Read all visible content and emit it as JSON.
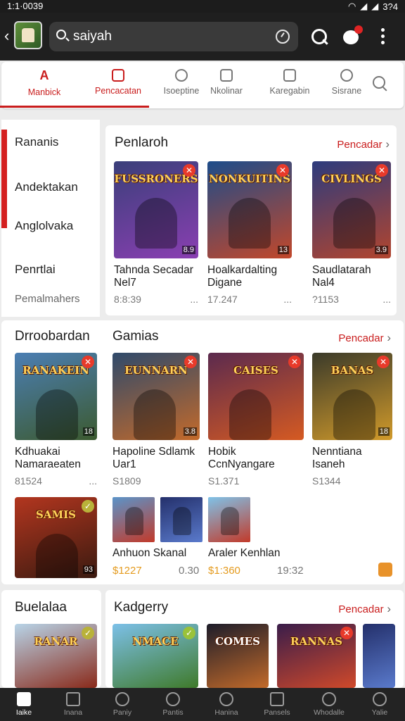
{
  "status_bar": {
    "time": "1:1·0039",
    "battery": "3?4"
  },
  "header": {
    "search_text": "saiyah"
  },
  "tabs": [
    {
      "label": "Manbick",
      "icon": "brand-logo-icon",
      "brand": "A"
    },
    {
      "label": "Pencacatan",
      "icon": "home-icon",
      "active": true
    },
    {
      "label": "Isoeptine",
      "icon": "shield-icon"
    },
    {
      "label": "Nkolinar",
      "icon": "robot-icon"
    },
    {
      "label": "Karegabin",
      "icon": "box-icon"
    },
    {
      "label": "Sisrane",
      "icon": "compass-icon"
    }
  ],
  "sidebar": {
    "items": [
      "Rananis",
      "Andektakan",
      "Anglolvaka",
      "Penrtlai",
      "Pemalmahers"
    ]
  },
  "section1": {
    "title": "Penlaroh",
    "more": "Pencadar",
    "cards": [
      {
        "title": "Tahnda Secadar Nel7",
        "meta": "8:8:39",
        "dots": "...",
        "logo": "FUSSRONERS",
        "rating": "8.9",
        "bg": "#3a3f7a",
        "bg2": "#8a3fb2"
      },
      {
        "title": "Hoalkardalting Digane",
        "meta": "17.247",
        "dots": "...",
        "logo": "NONKUITINS",
        "rating": "13",
        "bg": "#1d4c8a",
        "bg2": "#c2472a"
      },
      {
        "title": "Saudlatarah Nal4",
        "meta": "?1153",
        "dots": "...",
        "logo": "CIVLINGS",
        "rating": "3.9",
        "bg": "#2d3b7d",
        "bg2": "#b2452e"
      }
    ]
  },
  "section2": {
    "side_title": "Drroobardan",
    "title": "Gamias",
    "more": "Pencadar",
    "cards": [
      {
        "title": "Kdhuakai Namaraeaten",
        "meta": "81524",
        "dots": "...",
        "logo": "RANAKEIN",
        "rating": "18",
        "bg": "#4b7eb3",
        "bg2": "#3c5a2f"
      },
      {
        "title": "Hapoline Sdlamk Uar1",
        "meta": "S1809",
        "dots": "",
        "logo": "EUNNARN",
        "rating": "3.8",
        "bg": "#2f4a6b",
        "bg2": "#c46a2a"
      },
      {
        "title": "Hobik CcnNyangare",
        "meta": "S1.371",
        "dots": "",
        "logo": "CAISES",
        "rating": "",
        "bg": "#5b2a4e",
        "bg2": "#d55a22"
      },
      {
        "title": "Nenntiana Isaneh",
        "meta": "S1344",
        "dots": "",
        "logo": "BANAS",
        "rating": "18",
        "bg": "#3a3a2a",
        "bg2": "#d19a2a"
      }
    ],
    "row2": {
      "big_logo": "SAMIS",
      "big_rating": "93",
      "mini1_title": "Anhuon Skanal",
      "mini1_price": "$1227",
      "mini1_count": "0.30",
      "mini2_title": "Araler Kenhlan",
      "mini2_price": "$1:360",
      "mini2_count": "19:32"
    }
  },
  "section3": {
    "side_title": "Buelalaa",
    "title": "Kadgerry",
    "more": "Pencadar",
    "logos": [
      "RANAR",
      "NMACE",
      "COMES",
      "RANNAS",
      ""
    ]
  },
  "bottom_nav": [
    {
      "label": "Iaike",
      "icon": "home-icon",
      "active": true
    },
    {
      "label": "Inana",
      "icon": "library-icon"
    },
    {
      "label": "Paniy",
      "icon": "search-icon"
    },
    {
      "label": "Pantis",
      "icon": "search-alt-icon"
    },
    {
      "label": "Hanina",
      "icon": "controller-icon"
    },
    {
      "label": "Pansels",
      "icon": "triangle-icon"
    },
    {
      "label": "Whodalle",
      "icon": "magnify-icon"
    },
    {
      "label": "Yalie",
      "icon": "profile-icon"
    }
  ],
  "colors": {
    "accent": "#c91d1d",
    "price": "#e49b1f",
    "topbar": "#1f1f1f",
    "nav": "#232323"
  }
}
